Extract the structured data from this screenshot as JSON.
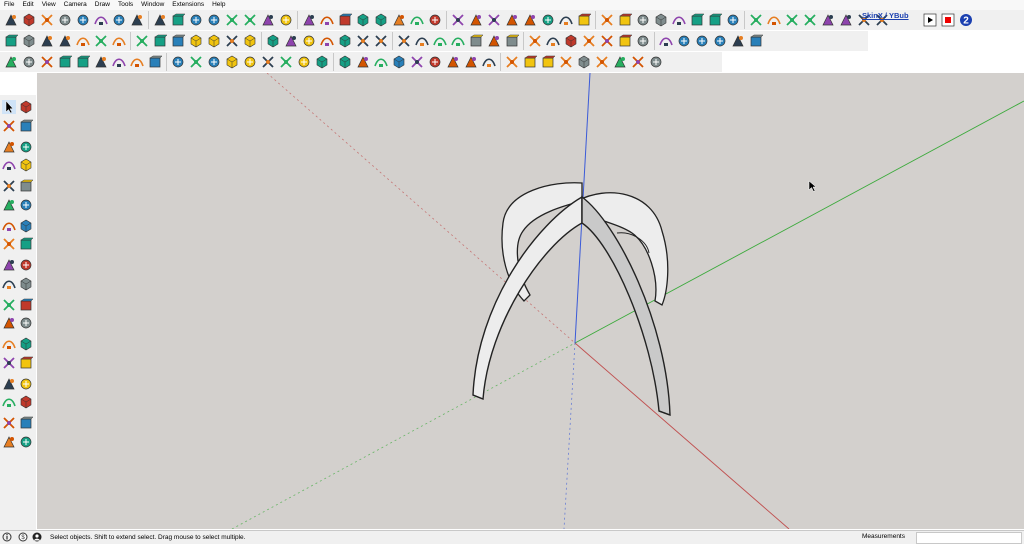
{
  "menu": [
    "File",
    "Edit",
    "View",
    "Camera",
    "Draw",
    "Tools",
    "Window",
    "Extensions",
    "Help"
  ],
  "toolbar": {
    "skinx_label": "SkinX / YBub",
    "row1_icons": [
      "dimension-tool-icon",
      "play-icon",
      "stop-icon",
      "rewind-icon",
      "cursor-hand-icon",
      "stamp-icon",
      "transform-icon",
      "stretch-icon",
      "eraser-icon",
      "wand-icon",
      "scale-icon",
      "move-icon",
      "rotate-icon",
      "paint-icon",
      "bezier-icon",
      "spline-icon",
      "loft-icon",
      "sweep-icon",
      "extrude-icon",
      "line-icon",
      "arc-icon",
      "curve-icon",
      "offset-icon",
      "path-icon",
      "mirror-icon",
      "sandbox-icon",
      "grid-icon",
      "shell-icon",
      "face-icon",
      "flip-icon",
      "wall-icon",
      "stairs-icon",
      "roof-icon",
      "beam-icon",
      "truss-icon",
      "window-icon",
      "door-icon",
      "column-icon",
      "hatch-icon",
      "render-icon",
      "material-icon",
      "light-icon",
      "camera-icon",
      "scene-icon",
      "export-icon",
      "layer-icon",
      "outliner-icon",
      "section-icon"
    ],
    "row1_right_icons": [
      "record-icon",
      "stop-red-icon",
      "help-plugin-icon"
    ],
    "row2_icons": [
      "smart-extrude-icon",
      "smart-push-icon",
      "smart-offset-icon",
      "smart-bevel-icon",
      "smart-fillet-icon",
      "smart-chamfer-icon",
      "smart-join-icon",
      "smart-split-icon",
      "ruler-icon",
      "curve-draw-icon",
      "pattern-icon",
      "layout-icon",
      "select-green-icon",
      "tree-icon",
      "component-icon",
      "box-a-icon",
      "box-b-icon",
      "box-c-icon",
      "box-d-icon",
      "box-e-icon",
      "text-icon",
      "tag-icon",
      "paint-bucket-icon",
      "globe-icon",
      "weld-icon",
      "bend-a-icon",
      "bend-b-icon",
      "wave-icon",
      "scissors-icon",
      "cross-icon",
      "magic-icon",
      "check-icon",
      "color-cube-icon",
      "dice-icon",
      "cubes-icon",
      "stone-icon",
      "cube-edit-icon",
      "red-cube-icon",
      "diamond-icon",
      "stack-icon",
      "grid-flat-icon"
    ],
    "row3_icons": [
      "iso-view-icon",
      "top-view-icon",
      "front-view-icon",
      "right-view-icon",
      "back-view-icon",
      "left-view-icon",
      "xray-icon",
      "wireframe-icon",
      "hidden-line-icon",
      "shaded-icon",
      "textured-icon",
      "mono-icon",
      "edges-icon",
      "profiles-icon",
      "paint-coin-icon",
      "sun-icon",
      "match-icon",
      "teapot-icon",
      "photo-icon",
      "section-plane-icon",
      "window-a-icon",
      "window-b-icon",
      "window-c-icon",
      "lock-icon",
      "umbrella-icon",
      "cube-3d-icon",
      "box-open-icon",
      "warehouse-icon",
      "tag-small-icon",
      "triangle-icon",
      "circle-icon",
      "protractor-icon",
      "axes-icon",
      "burst-icon",
      "arc-tool-icon",
      "dots-icon"
    ]
  },
  "left_tools": [
    "select-icon",
    "component-icon",
    "paint-icon",
    "eraser-icon",
    "pencil-icon",
    "freehand-icon",
    "rectangle-icon",
    "rotated-rect-icon",
    "circle-icon",
    "polygon-icon",
    "arc-icon",
    "pie-icon",
    "two-point-arc-icon",
    "three-point-arc-icon",
    "move-icon",
    "push-pull-icon",
    "rotate-icon",
    "follow-me-icon",
    "scale-icon",
    "offset-icon",
    "tape-icon",
    "text-icon",
    "protractor-icon",
    "3d-text-icon",
    "axes-icon",
    "section-icon",
    "orbit-icon",
    "pan-icon",
    "zoom-icon",
    "zoom-window-icon",
    "zoom-extents-icon",
    "zoom-previous-icon",
    "position-camera-icon",
    "look-around-icon",
    "walk-icon",
    "footprint-icon"
  ],
  "viewport": {
    "background": "#d3d0cd",
    "axis_red": "#c05050",
    "axis_green": "#3caa3c",
    "axis_blue": "#3a5ad8"
  },
  "status": {
    "message": "Select objects. Shift to extend select. Drag mouse to select multiple.",
    "measurements_label": "Measurements",
    "measurements_value": ""
  }
}
